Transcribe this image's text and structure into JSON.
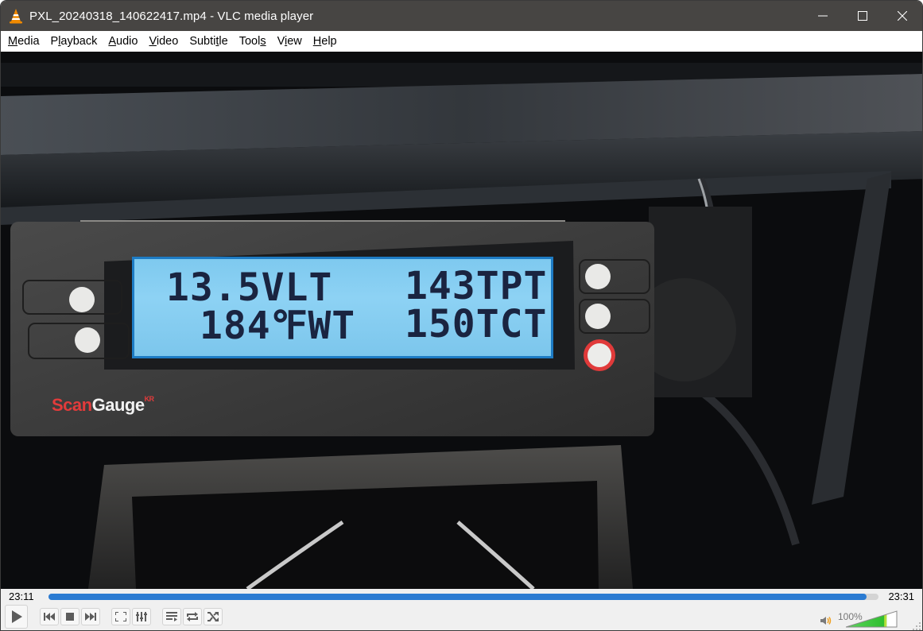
{
  "window": {
    "title": "PXL_20240318_140622417.mp4 - VLC media player",
    "app_icon": "vlc-cone-icon",
    "controls": [
      "minimize-icon",
      "maximize-icon",
      "close-icon"
    ]
  },
  "menu": [
    {
      "label_pre": "",
      "accel": "M",
      "label_post": "edia"
    },
    {
      "label_pre": "P",
      "accel": "l",
      "label_post": "ayback"
    },
    {
      "label_pre": "",
      "accel": "A",
      "label_post": "udio"
    },
    {
      "label_pre": "",
      "accel": "V",
      "label_post": "ideo"
    },
    {
      "label_pre": "Subti",
      "accel": "t",
      "label_post": "le"
    },
    {
      "label_pre": "Tool",
      "accel": "s",
      "label_post": ""
    },
    {
      "label_pre": "V",
      "accel": "i",
      "label_post": "ew"
    },
    {
      "label_pre": "",
      "accel": "H",
      "label_post": "elp"
    }
  ],
  "video_frame": {
    "description": "ScanGauge display mounted on car dashboard",
    "lcd": {
      "line1_left": "13.5VLT",
      "line1_right": "143TPT",
      "line2_left": "184℉WT",
      "line2_right": "150TCT"
    },
    "brand": {
      "part1": "Scan",
      "part2": "Gauge",
      "suffix": "KR"
    }
  },
  "playback": {
    "elapsed": "23:11",
    "total": "23:31",
    "progress_fraction": 0.986
  },
  "buttons": {
    "play": "play-icon",
    "previous": "previous-icon",
    "stop": "stop-icon",
    "next": "next-icon",
    "fullscreen": "fullscreen-icon",
    "extended_settings": "equalizer-icon",
    "playlist": "playlist-icon",
    "loop": "loop-icon",
    "random": "shuffle-icon"
  },
  "volume": {
    "label": "100%",
    "level_fraction": 0.8,
    "icon": "speaker-icon"
  },
  "colors": {
    "titlebar": "#474543",
    "seek_fill": "#2b7bd2",
    "volume_fill": "#3cc83c",
    "vlc_orange": "#f08a00",
    "lcd_blue": "#8dd2f4"
  }
}
